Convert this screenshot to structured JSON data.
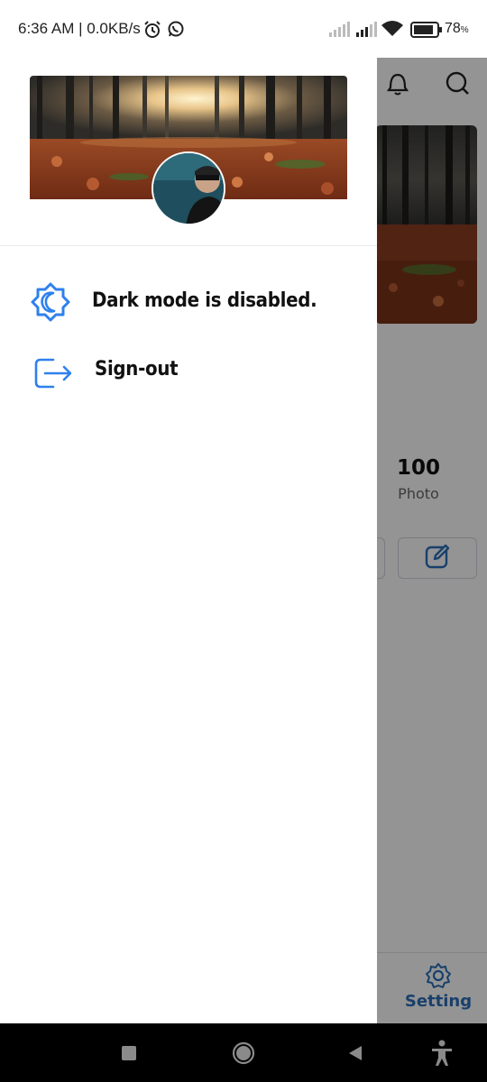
{
  "status_bar": {
    "time_speed": "6:36 AM | 0.0KB/s",
    "battery_percent": "78",
    "battery_unit": "%",
    "icons": [
      "alarm-icon",
      "whatsapp-icon",
      "signal-icon",
      "signal-icon",
      "wifi-icon",
      "battery-icon"
    ]
  },
  "drawer": {
    "cover_image": "forest-sunrise-image",
    "avatar_image": "profile-avatar",
    "menu": [
      {
        "icon": "dark-mode-icon",
        "label": "Dark mode is disabled."
      },
      {
        "icon": "sign-out-icon",
        "label": "Sign-out"
      }
    ]
  },
  "background": {
    "header_icons": [
      "bell-icon",
      "search-icon"
    ],
    "stats": {
      "count": "100",
      "label": "Photo"
    },
    "bottom_nav": {
      "label": "Setting",
      "icon": "gear-icon"
    }
  },
  "nav_bar": {
    "icons": [
      "recents-square-icon",
      "home-circle-icon",
      "back-triangle-icon",
      "accessibility-icon"
    ]
  },
  "colors": {
    "accent_blue": "#2f80ed",
    "setting_blue": "#2b6fb8",
    "text_dark": "#111111",
    "scrim": "rgba(0,0,0,0.42)"
  }
}
